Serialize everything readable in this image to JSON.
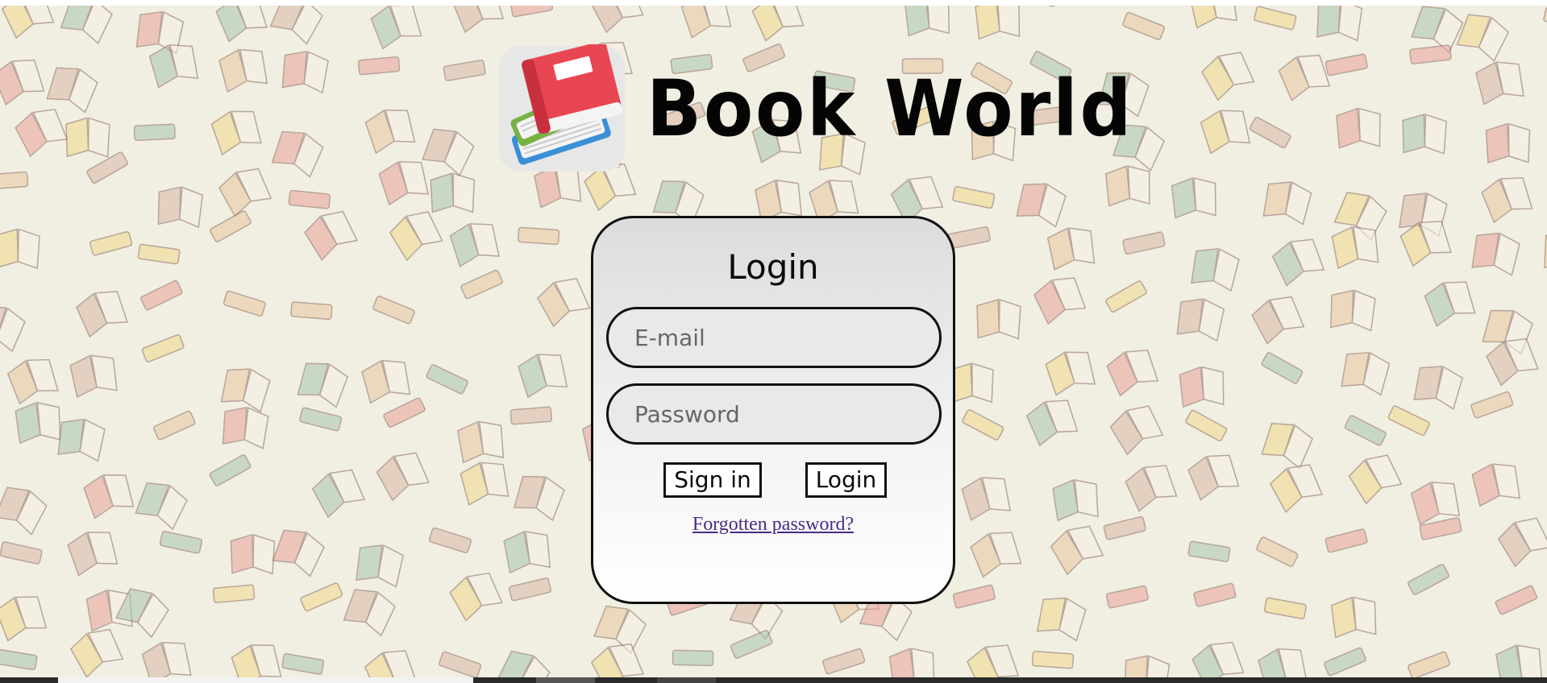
{
  "header": {
    "title": "Book World",
    "logo_icon": "stacked-books-icon"
  },
  "login": {
    "title": "Login",
    "email_placeholder": "E-mail",
    "password_placeholder": "Password",
    "signin_label": "Sign in",
    "login_label": "Login",
    "forgot_label": "Forgotten password?"
  },
  "colors": {
    "background": "#f1eee2",
    "card_border": "#111111",
    "link": "#4b2a86",
    "book_red": "#e94653",
    "book_green": "#78b244",
    "book_blue": "#3a8fd6"
  }
}
